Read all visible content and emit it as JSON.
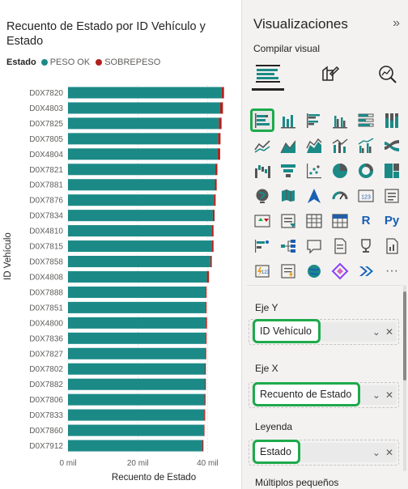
{
  "chart": {
    "title": "Recuento de Estado por ID Vehículo y Estado",
    "legend_title": "Estado",
    "y_axis_title": "ID Vehículo",
    "x_axis_title": "Recuento de Estado"
  },
  "chart_data": {
    "type": "bar",
    "orientation": "horizontal",
    "stacked": true,
    "title": "Recuento de Estado por ID Vehículo y Estado",
    "xlabel": "Recuento de Estado",
    "ylabel": "ID Vehículo",
    "xlim": [
      0,
      45000
    ],
    "x_ticks": [
      "0 mil",
      "20 mil",
      "40 mil"
    ],
    "x_tick_values": [
      0,
      20000,
      40000
    ],
    "grid": true,
    "legend": "top-left",
    "categories": [
      "D0X7820",
      "D0X4803",
      "D0X7825",
      "D0X7805",
      "D0X4804",
      "D0X7821",
      "D0X7881",
      "D0X7876",
      "D0X7834",
      "D0X4810",
      "D0X7815",
      "D0X7858",
      "D0X4808",
      "D0X7888",
      "D0X7851",
      "D0X4800",
      "D0X7836",
      "D0X7827",
      "D0X7802",
      "D0X7882",
      "D0X7806",
      "D0X7833",
      "D0X7860",
      "D0X7912"
    ],
    "series": [
      {
        "name": "PESO OK",
        "color": "#1b8a87",
        "values": [
          44000,
          43600,
          43200,
          43000,
          42900,
          42200,
          42100,
          41800,
          41500,
          41200,
          41200,
          40800,
          39800,
          39400,
          39400,
          39400,
          39400,
          39300,
          39200,
          39200,
          39100,
          39000,
          38800,
          38500
        ]
      },
      {
        "name": "SOBREPESO",
        "color": "#b2221d",
        "values": [
          700,
          800,
          800,
          700,
          700,
          600,
          500,
          500,
          500,
          500,
          500,
          400,
          600,
          300,
          300,
          400,
          300,
          300,
          300,
          300,
          300,
          300,
          300,
          300
        ]
      }
    ]
  },
  "pane": {
    "title": "Visualizaciones",
    "collapse_glyph": "»",
    "subtabs_label": "Compilar visual",
    "subtabs": [
      {
        "name": "build-visual-icon"
      },
      {
        "name": "format-visual-icon"
      },
      {
        "name": "analytics-icon"
      }
    ],
    "r_label": "R",
    "py_label": "Py",
    "more_label": "···",
    "wells": [
      {
        "label": "Eje Y",
        "field": "ID Vehículo"
      },
      {
        "label": "Eje X",
        "field": "Recuento de Estado"
      },
      {
        "label": "Leyenda",
        "field": "Estado"
      }
    ],
    "next_section": "Múltiplos pequeños",
    "accent": "#1eaa4c"
  }
}
